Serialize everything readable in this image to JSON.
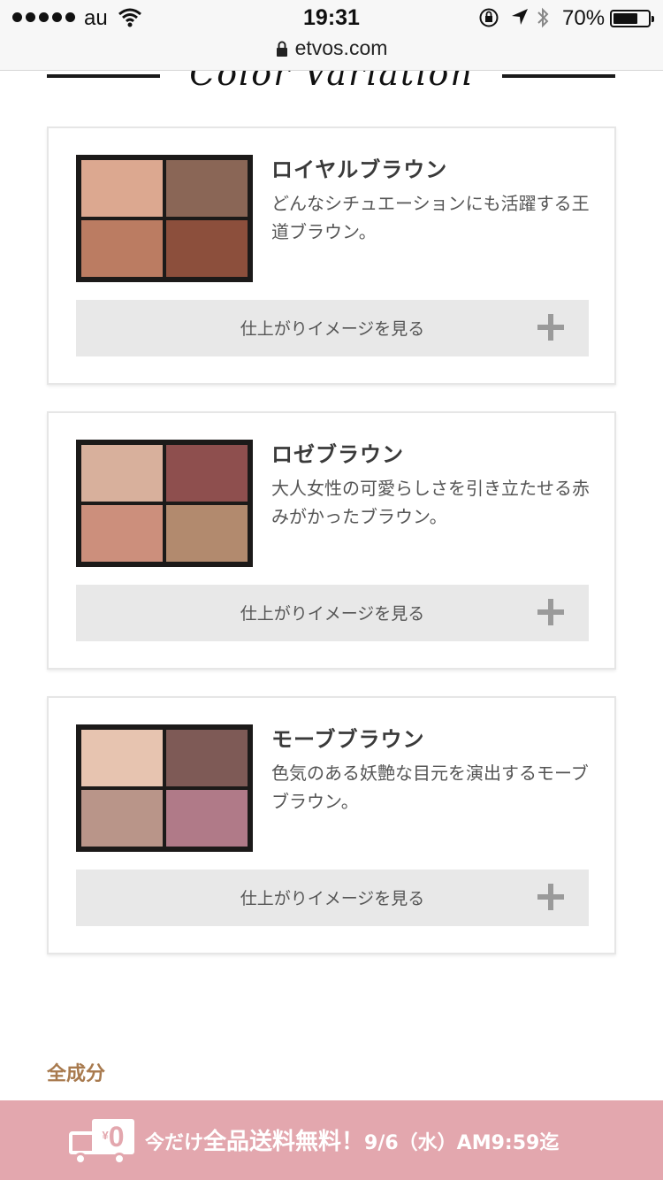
{
  "status_bar": {
    "carrier": "au",
    "time": "19:31",
    "battery_percent": "70%",
    "battery_level": 0.7
  },
  "browser": {
    "url": "etvos.com"
  },
  "section": {
    "script_title": "Color Variation"
  },
  "variations": [
    {
      "name": "ロイヤルブラウン",
      "description": "どんなシチュエーションにも活躍する王道ブラウン。",
      "button_label": "仕上がりイメージを見る",
      "pan_colors": [
        "#dca890",
        "#8a6656",
        "#bb7c62",
        "#8c4f3c"
      ]
    },
    {
      "name": "ロゼブラウン",
      "description": "大人女性の可愛らしさを引き立たせる赤みがかったブラウン。",
      "button_label": "仕上がりイメージを見る",
      "pan_colors": [
        "#d8b09c",
        "#8e4f4e",
        "#cc8f7c",
        "#b28a6e"
      ]
    },
    {
      "name": "モーブブラウン",
      "description": "色気のある妖艶な目元を演出するモーブブラウン。",
      "button_label": "仕上がりイメージを見る",
      "pan_colors": [
        "#e7c4b0",
        "#7e5a56",
        "#b99589",
        "#b07a88"
      ]
    }
  ],
  "ingredients": {
    "heading": "全成分"
  },
  "promo": {
    "yen": "¥",
    "zero": "0",
    "text_small": "今だけ",
    "text_big": "全品送料無料！",
    "deadline": "9/6（水）AM9:59迄"
  },
  "colors": {
    "banner_bg": "#e3a7ae",
    "ingredients_heading": "#a87a4e",
    "button_bg": "#e8e8e8"
  }
}
